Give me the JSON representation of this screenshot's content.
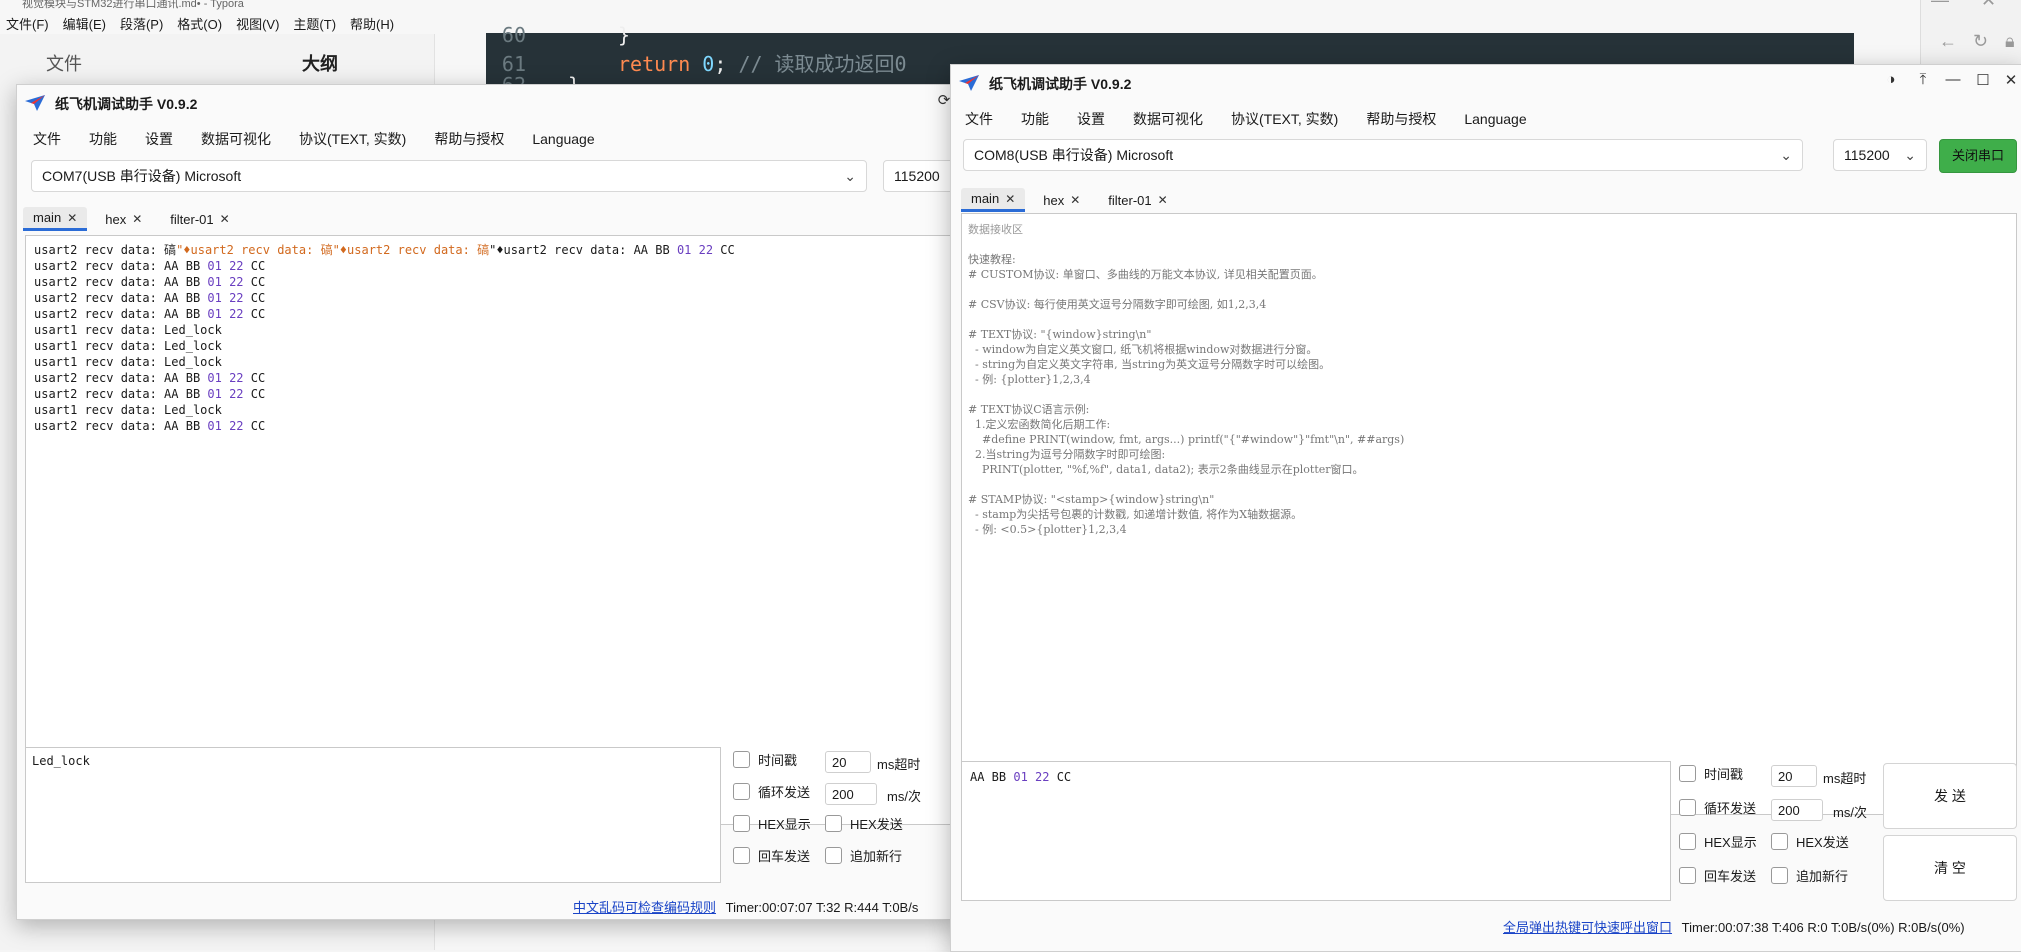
{
  "typora": {
    "title": "视觉模块与STM32进行串口通讯.md• - Typora",
    "menu": [
      "文件(F)",
      "编辑(E)",
      "段落(P)",
      "格式(O)",
      "视图(V)",
      "主题(T)",
      "帮助(H)"
    ],
    "sidebar_tabs": [
      "文件",
      "大纲"
    ],
    "code": {
      "line60_no": "60",
      "line60": "}",
      "line61_no": "61",
      "line61_kw": "return",
      "line61_num": "0",
      "line61_rest": ";",
      "line61_comment": "// 读取成功返回0",
      "line62_no": "62",
      "line62": "}"
    }
  },
  "left": {
    "title": "纸飞机调试助手 V0.9.2",
    "menu": [
      "文件",
      "功能",
      "设置",
      "数据可视化",
      "协议(TEXT, 实数)",
      "帮助与授权",
      "Language"
    ],
    "port": "COM7(USB 串行设备) Microsoft",
    "baud": "115200",
    "tabs": [
      "main",
      "hex",
      "filter-01"
    ],
    "recv_first": {
      "a": "usart2 recv data: ",
      "g1": "碻",
      "b": "\"♦usart2 recv data: ",
      "g2": "碻",
      "c": "\"♦usart2 recv data: ",
      "g3": "碻",
      "d": "\"♦usart2 recv data: AA BB ",
      "e": "01 22",
      "f": " CC"
    },
    "recv_lines": [
      {
        "pre": "usart2 recv data: AA BB ",
        "hex": "01 22",
        "post": " CC"
      },
      {
        "pre": "usart2 recv data: AA BB ",
        "hex": "01 22",
        "post": " CC"
      },
      {
        "pre": "usart2 recv data: AA BB ",
        "hex": "01 22",
        "post": " CC"
      },
      {
        "pre": "usart2 recv data: AA BB ",
        "hex": "01 22",
        "post": " CC"
      },
      {
        "pre": "usart1 recv data: Led_lock",
        "hex": "",
        "post": ""
      },
      {
        "pre": "usart1 recv data: Led_lock",
        "hex": "",
        "post": ""
      },
      {
        "pre": "usart1 recv data: Led_lock",
        "hex": "",
        "post": ""
      },
      {
        "pre": "usart2 recv data: AA BB ",
        "hex": "01 22",
        "post": " CC"
      },
      {
        "pre": "usart2 recv data: AA BB ",
        "hex": "01 22",
        "post": " CC"
      },
      {
        "pre": "usart1 recv data: Led_lock",
        "hex": "",
        "post": ""
      },
      {
        "pre": "usart2 recv data: AA BB ",
        "hex": "01 22",
        "post": " CC"
      }
    ],
    "send_text": "Led_lock",
    "opts": {
      "timestamp": "时间戳",
      "timeout_value": "20",
      "timeout_unit": "ms超时",
      "loop_send": "循环发送",
      "loop_value": "200",
      "loop_unit": "ms/次",
      "hex_display": "HEX显示",
      "hex_send": "HEX发送",
      "cr_send": "回车发送",
      "append_newline": "追加新行"
    },
    "status_link": "中文乱码可检查编码规则",
    "status": "Timer:00:07:07  T:32 R:444   T:0B/s"
  },
  "right": {
    "title": "纸飞机调试助手 V0.9.2",
    "menu": [
      "文件",
      "功能",
      "设置",
      "数据可视化",
      "协议(TEXT, 实数)",
      "帮助与授权",
      "Language"
    ],
    "port": "COM8(USB 串行设备) Microsoft",
    "baud": "115200",
    "close_port": "关闭串口",
    "tabs": [
      "main",
      "hex",
      "filter-01"
    ],
    "recv_placeholder": "数据接收区",
    "help_lines": [
      "快速教程:",
      "# CUSTOM协议: 单窗口、多曲线的万能文本协议, 详见相关配置页面。",
      "",
      "# CSV协议: 每行使用英文逗号分隔数字即可绘图, 如1,2,3,4",
      "",
      "# TEXT协议: \"{window}string\\n\"",
      "  - window为自定义英文窗口, 纸飞机将根据window对数据进行分窗。",
      "  - string为自定义英文字符串, 当string为英文逗号分隔数字时可以绘图。",
      "  - 例: {plotter}1,2,3,4",
      "",
      "# TEXT协议C语言示例:",
      "  1.定义宏函数简化后期工作:",
      "    #define PRINT(window, fmt, args...) printf(\"{\"#window\"}\"fmt\"\\n\", ##args)",
      "  2.当string为逗号分隔数字时即可绘图:",
      "    PRINT(plotter, \"%f,%f\", data1, data2); 表示2条曲线显示在plotter窗口。",
      "",
      "# STAMP协议: \"<stamp>{window}string\\n\"",
      "  - stamp为尖括号包裹的计数戳, 如递增计数值, 将作为X轴数据源。",
      "  - 例: <0.5>{plotter}1,2,3,4"
    ],
    "send": {
      "pre": "AA BB ",
      "hex": "01 22",
      "post": " CC"
    },
    "opts": {
      "timestamp": "时间戳",
      "timeout_value": "20",
      "timeout_unit": "ms超时",
      "loop_send": "循环发送",
      "loop_value": "200",
      "loop_unit": "ms/次",
      "hex_display": "HEX显示",
      "hex_send": "HEX发送",
      "cr_send": "回车发送",
      "append_newline": "追加新行"
    },
    "send_btn": "发 送",
    "clear_btn": "清 空",
    "status_link": "全局弹出热键可快速呼出窗口",
    "status": "Timer:00:07:38  T:406 R:0   T:0B/s(0%) R:0B/s(0%)"
  }
}
